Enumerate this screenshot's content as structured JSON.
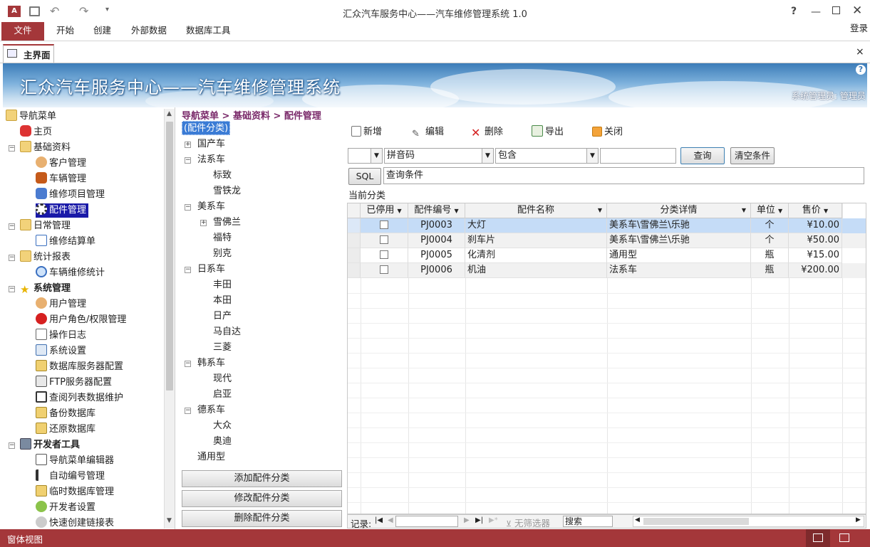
{
  "window": {
    "title": "汇众汽车服务中心——汽车维修管理系统 1.0",
    "app_icon": "access-icon",
    "help": "?",
    "login": "登录"
  },
  "ribbon": {
    "tabs": [
      "文件",
      "开始",
      "创建",
      "外部数据",
      "数据库工具"
    ]
  },
  "doc_tab": {
    "label": "主界面",
    "close": "×"
  },
  "banner": {
    "title": "汇众汽车服务中心——汽车维修管理系统",
    "user": "系统管理员: 管理员",
    "help": "?"
  },
  "nav": {
    "items": [
      {
        "label": "导航菜单",
        "icon": "folder-open-icon"
      },
      {
        "label": "主页",
        "icon": "car-icon"
      },
      {
        "label": "基础资料",
        "icon": "folder-open-icon"
      },
      {
        "label": "客户管理",
        "icon": "users-icon"
      },
      {
        "label": "车辆管理",
        "icon": "car-icon"
      },
      {
        "label": "维修项目管理",
        "icon": "car-icon"
      },
      {
        "label": "配件管理",
        "icon": "gear-icon"
      },
      {
        "label": "日常管理",
        "icon": "folder-open-icon"
      },
      {
        "label": "维修结算单",
        "icon": "edit-icon"
      },
      {
        "label": "统计报表",
        "icon": "folder-open-icon"
      },
      {
        "label": "车辆维修统计",
        "icon": "magnifier-icon"
      },
      {
        "label": "系统管理",
        "icon": "star-icon"
      },
      {
        "label": "用户管理",
        "icon": "users-icon"
      },
      {
        "label": "用户角色/权限管理",
        "icon": "stop-icon"
      },
      {
        "label": "操作日志",
        "icon": "document-icon"
      },
      {
        "label": "系统设置",
        "icon": "settings-icon"
      },
      {
        "label": "数据库服务器配置",
        "icon": "database-icon"
      },
      {
        "label": "FTP服务器配置",
        "icon": "server-icon"
      },
      {
        "label": "查阅列表数据维护",
        "icon": "list-icon"
      },
      {
        "label": "备份数据库",
        "icon": "database-icon"
      },
      {
        "label": "还原数据库",
        "icon": "database-icon"
      },
      {
        "label": "开发者工具",
        "icon": "tools-icon"
      },
      {
        "label": "导航菜单编辑器",
        "icon": "edit-icon"
      },
      {
        "label": "自动编号管理",
        "icon": "list-icon"
      },
      {
        "label": "临时数据库管理",
        "icon": "database-icon"
      },
      {
        "label": "开发者设置",
        "icon": "settings-icon"
      },
      {
        "label": "快速创建链接表",
        "icon": "link-icon"
      }
    ]
  },
  "breadcrumb": "导航菜单 > 基础资料 > 配件管理",
  "category_tree": {
    "root": "(配件分类)",
    "nodes": [
      "国产车",
      "法系车",
      "标致",
      "雪铁龙",
      "美系车",
      "雪佛兰",
      "福特",
      "别克",
      "日系车",
      "丰田",
      "本田",
      "日产",
      "马自达",
      "三菱",
      "韩系车",
      "现代",
      "启亚",
      "德系车",
      "大众",
      "奥迪",
      "通用型"
    ]
  },
  "category_buttons": [
    "添加配件分类",
    "修改配件分类",
    "删除配件分类"
  ],
  "toolbar": {
    "new": "新增",
    "edit": "编辑",
    "delete": "删除",
    "export": "导出",
    "close": "关闭"
  },
  "filter": {
    "field_value": "拼音码",
    "operator": "包含",
    "query": "查询",
    "clear": "清空条件",
    "sql": "SQL",
    "condition": "查询条件"
  },
  "current_category": "当前分类",
  "table": {
    "headers": [
      "已停用",
      "配件编号",
      "配件名称",
      "分类详情",
      "单位",
      "售价"
    ],
    "rows": [
      [
        "",
        "PJ0003",
        "大灯",
        "美系车\\雪佛兰\\乐驰",
        "个",
        "¥10.00"
      ],
      [
        "",
        "PJ0004",
        "刹车片",
        "美系车\\雪佛兰\\乐驰",
        "个",
        "¥50.00"
      ],
      [
        "",
        "PJ0005",
        "化清剂",
        "通用型",
        "瓶",
        "¥15.00"
      ],
      [
        "",
        "PJ0006",
        "机油",
        "法系车",
        "瓶",
        "¥200.00"
      ]
    ]
  },
  "record_bar": {
    "label": "记录:",
    "no_filter": "无筛选器",
    "search": "搜索"
  },
  "status": {
    "text": "窗体视图"
  },
  "colors": {
    "accent": "#a4373a",
    "selected_row": "#c5dcf7",
    "nav_selected": "#1a1aa8",
    "breadcrumb": "#7a2a6a"
  }
}
